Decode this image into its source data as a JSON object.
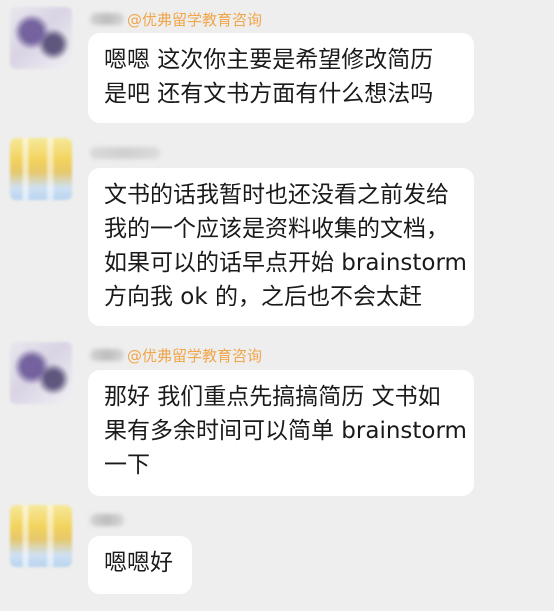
{
  "messages": [
    {
      "sender_tag": "@优弗留学教育咨询",
      "lines": [
        "嗯嗯 这次你主要是希望修改简历",
        "是吧 还有文书方面有什么想法吗"
      ]
    },
    {
      "sender_tag": "",
      "lines": [
        "文书的话我暂时也还没看之前发给",
        "我的一个应该是资料收集的文档，",
        "如果可以的话早点开始 brainstorm",
        "方向我 ok 的，之后也不会太赶"
      ]
    },
    {
      "sender_tag": "@优弗留学教育咨询",
      "lines": [
        "那好 我们重点先搞搞简历 文书如",
        "果有多余时间可以简单 brainstorm",
        "一下"
      ]
    },
    {
      "sender_tag": "",
      "lines": [
        "嗯嗯好"
      ]
    }
  ]
}
